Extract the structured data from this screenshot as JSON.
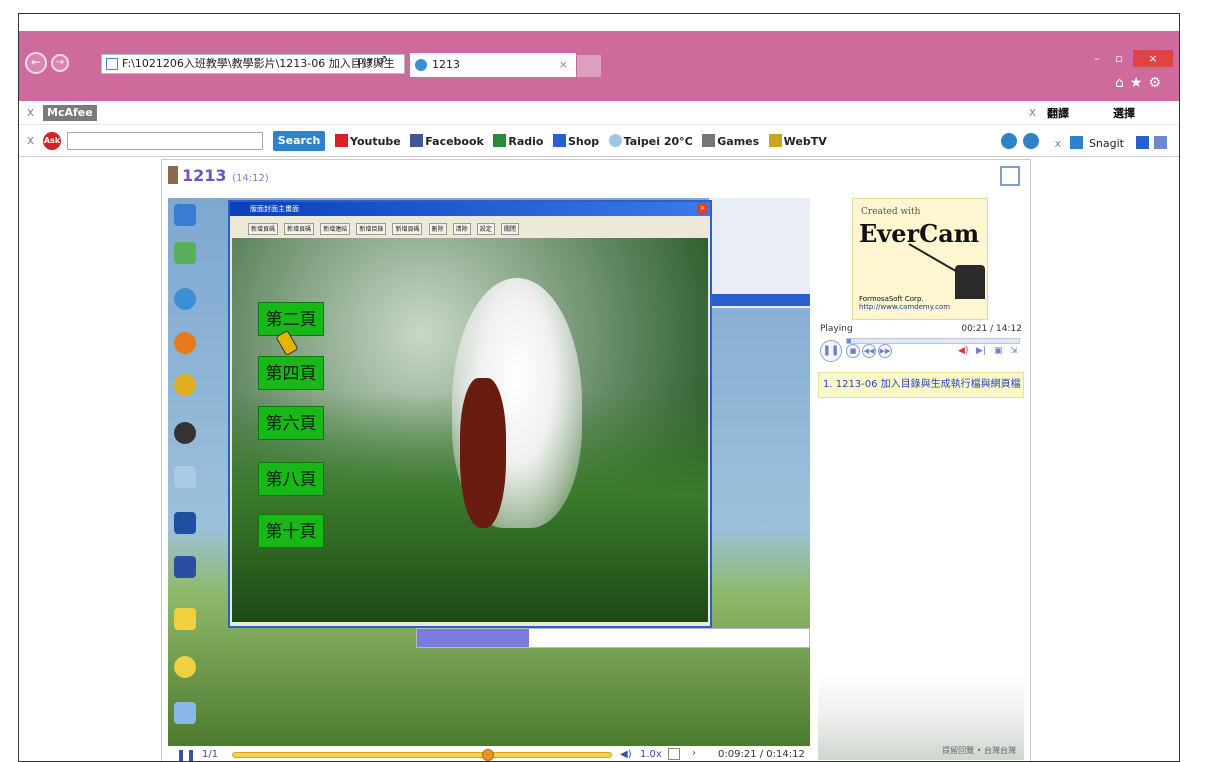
{
  "browser": {
    "address": "F:\\1021206入班教學\\教學影片\\1213-06 加入目錄與生",
    "address_tools": "ρ ▾ ♂",
    "tab_title": "1213",
    "tab_close": "×",
    "window_controls": {
      "minimize": "–",
      "maximize": "▫",
      "close": "×"
    },
    "right_icons": "⌂★⚙",
    "nav_back": "←",
    "nav_forward": "→"
  },
  "toolbar1": {
    "close_x": "x",
    "mcafee_label": "McAfee",
    "right_close_x": "x",
    "translate_label": "翻譯",
    "select_label": "選擇"
  },
  "toolbar2": {
    "close_x": "x",
    "ask_label": "Ask",
    "search_button": "Search",
    "links": [
      "Youtube",
      "Facebook",
      "Radio",
      "Shop",
      "Taipei 20°C",
      "Games",
      "WebTV"
    ],
    "right_close_x": "x",
    "snagit_label": "Snagit"
  },
  "player": {
    "title": "1213",
    "duration_small": "(14:12)",
    "dialog_title": "版面封面主畫面",
    "dialog_close": "×",
    "dialog_buttons": [
      "新增頁碼",
      "新增頁碼",
      "新增連結",
      "新增目錄",
      "新增頁碼",
      "刪除",
      "清除",
      "設定",
      "關閉"
    ],
    "page_buttons": [
      "第二頁",
      "第四頁",
      "第六頁",
      "第八頁",
      "第十頁"
    ],
    "status_playing": "Playing",
    "status_time": "00:21 / 14:12",
    "chapter_item": "1. 1213-06 加入目錄與生成執行檔與網頁檔",
    "evercam_created": "Created with",
    "evercam_brand": "EverCam",
    "evercam_corp": "FormosaSoft Corp.",
    "evercam_url": "http://www.camdemy.com",
    "side_art_caption": "提留回覽 • 台灣台灣",
    "sidebar_progress": 0.025,
    "bottom": {
      "page_indicator": "1/1",
      "speed": "1.0x",
      "time": "0:09:21 / 0:14:12",
      "progress": 0.658
    }
  },
  "colors": {
    "titlebar": "#cf6a9c",
    "accent_purple": "#6a55c8",
    "page_button_green": "#17b817",
    "seek_yellow": "#f4d44a"
  }
}
